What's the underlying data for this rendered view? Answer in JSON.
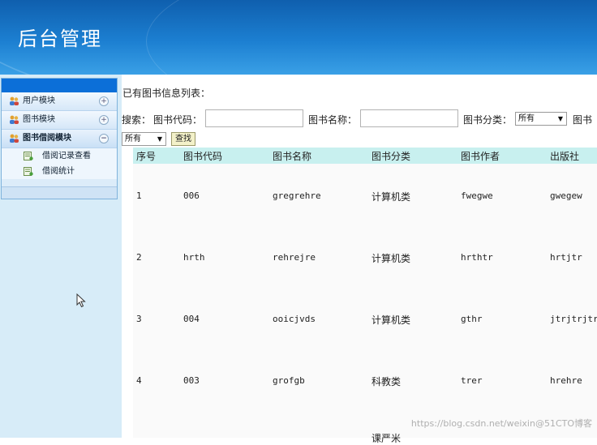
{
  "header": {
    "title": "后台管理"
  },
  "sidebar": {
    "modules": [
      {
        "label": "用户模块",
        "toggle": "+",
        "active": false
      },
      {
        "label": "图书模块",
        "toggle": "+",
        "active": false
      },
      {
        "label": "图书借阅模块",
        "toggle": "−",
        "active": true
      }
    ],
    "subitems": [
      {
        "label": "借阅记录查看"
      },
      {
        "label": "借阅统计"
      }
    ]
  },
  "main": {
    "list_title": "已有图书信息列表：",
    "search": {
      "label": "搜索：",
      "code_label": "图书代码：",
      "code_value": "",
      "name_label": "图书名称：",
      "name_value": "",
      "category_label": "图书分类：",
      "category_value": "所有",
      "author_label": "图书",
      "second_select_value": "所有",
      "button": "查找"
    },
    "table": {
      "headers": [
        "序号",
        "图书代码",
        "图书名称",
        "图书分类",
        "图书作者",
        "出版社"
      ],
      "rows": [
        [
          "1",
          "006",
          "gregrehre",
          "计算机类",
          "fwegwe",
          "gwegew"
        ],
        [
          "2",
          "hrth",
          "rehrejre",
          "计算机类",
          "hrthtr",
          "hrtjtr"
        ],
        [
          "3",
          "004",
          "ooicjvds",
          "计算机类",
          "gthr",
          "jtrjtrjtr"
        ],
        [
          "4",
          "003",
          "grofgb",
          "科教类",
          "trer",
          "hrehre"
        ]
      ],
      "partial_next_row_category": "课严米"
    }
  },
  "watermark": "https://blog.csdn.net/weixin@51CTO博客"
}
